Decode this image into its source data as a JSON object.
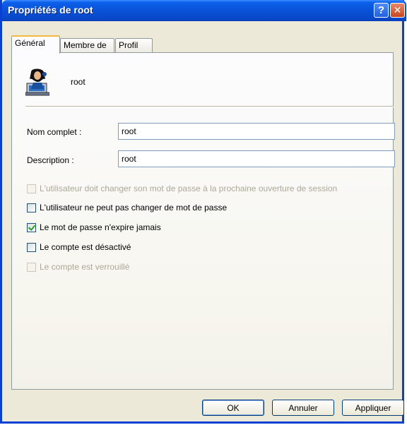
{
  "window": {
    "title": "Propriétés de root"
  },
  "tabs": [
    {
      "label": "Général",
      "active": true
    },
    {
      "label": "Membre de",
      "active": false
    },
    {
      "label": "Profil",
      "active": false
    }
  ],
  "user": {
    "name": "root",
    "icon": "user-icon"
  },
  "fields": {
    "full_name": {
      "label": "Nom complet :",
      "value": "root"
    },
    "description": {
      "label": "Description :",
      "value": "root"
    }
  },
  "options": [
    {
      "label": "L'utilisateur doit changer son mot de passe à la prochaine ouverture de session",
      "checked": false,
      "enabled": false
    },
    {
      "label": "L'utilisateur ne peut pas changer de mot de passe",
      "checked": false,
      "enabled": true
    },
    {
      "label": "Le mot de passe n'expire jamais",
      "checked": true,
      "enabled": true
    },
    {
      "label": "Le compte est désactivé",
      "checked": false,
      "enabled": true
    },
    {
      "label": "Le compte est verrouillé",
      "checked": false,
      "enabled": false
    }
  ],
  "buttons": {
    "ok": "OK",
    "cancel": "Annuler",
    "apply": "Appliquer"
  },
  "colors": {
    "titlebar": "#0a52d8",
    "accent_tab": "#f5b93d",
    "check": "#21a121"
  }
}
